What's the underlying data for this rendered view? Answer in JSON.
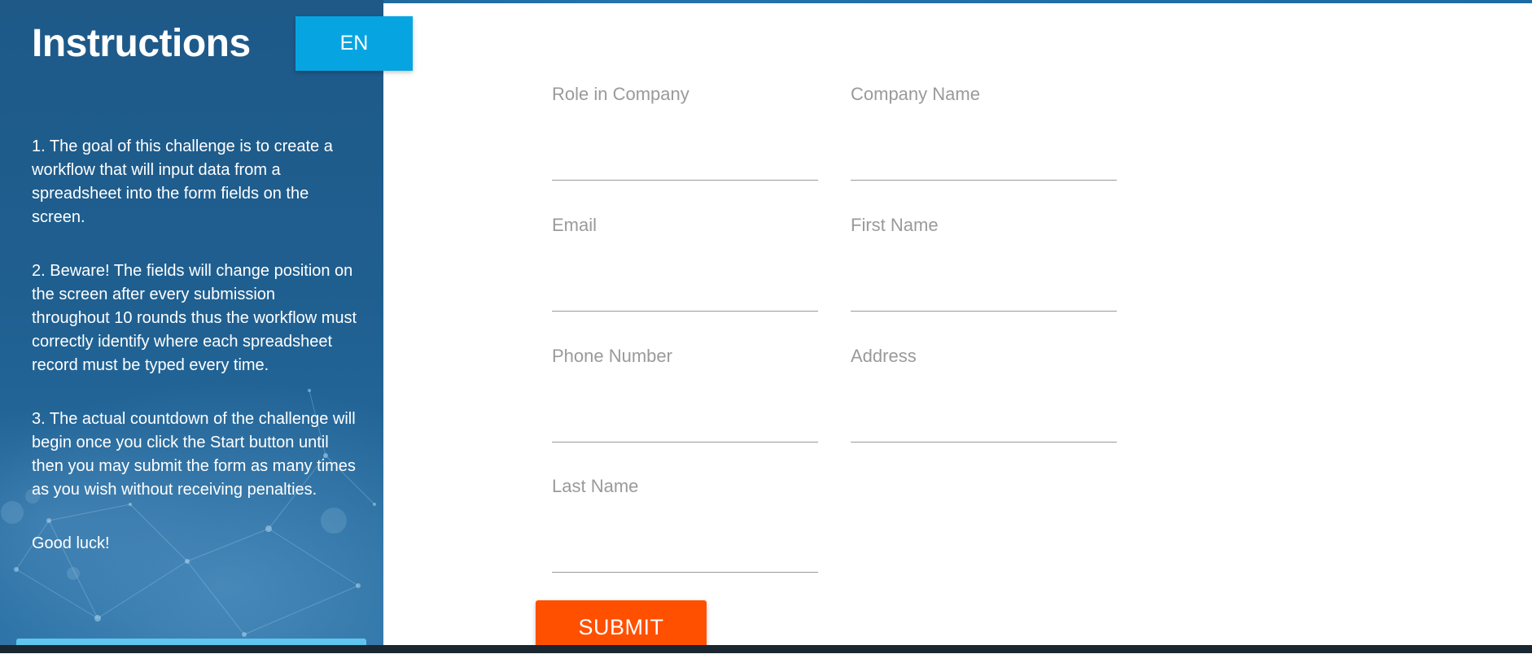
{
  "sidebar": {
    "title": "Instructions",
    "language_button": "EN",
    "paragraphs": [
      "1. The goal of this challenge is to create a workflow that will input data from a spreadsheet into the form fields on the screen.",
      "2. Beware! The fields will change position on the screen after every submission throughout 10 rounds thus the workflow must correctly identify where each spreadsheet record must be typed every time.",
      "3. The actual countdown of the challenge will begin once you click the Start button until then you may submit the form as many times as you wish without receiving penalties.",
      "Good luck!"
    ]
  },
  "form": {
    "fields": [
      {
        "label": "Role in Company",
        "value": ""
      },
      {
        "label": "Company Name",
        "value": ""
      },
      {
        "label": "Email",
        "value": ""
      },
      {
        "label": "First Name",
        "value": ""
      },
      {
        "label": "Phone Number",
        "value": ""
      },
      {
        "label": "Address",
        "value": ""
      },
      {
        "label": "Last Name",
        "value": ""
      }
    ],
    "submit_label": "SUBMIT"
  },
  "colors": {
    "sidebar_bg": "#1f5f90",
    "language_button": "#06a5e2",
    "submit_button": "#ff5000",
    "label_text": "#9a9a9a"
  }
}
